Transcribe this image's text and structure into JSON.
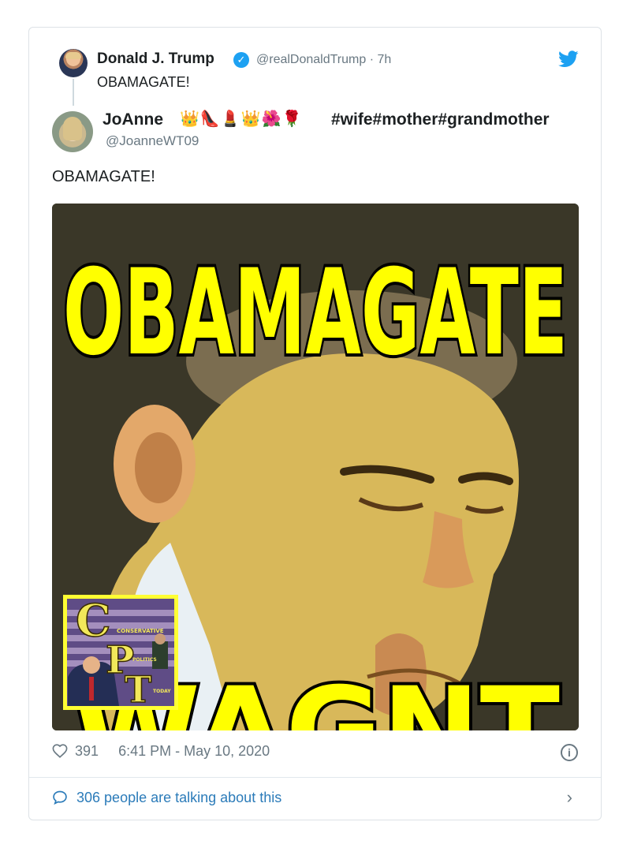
{
  "outer_tweet": {
    "author_name": "Donald J. Trump",
    "verified_glyph": "✓",
    "handle": "@realDonaldTrump",
    "time_sep": "·",
    "time": "7h",
    "text": "OBAMAGATE!"
  },
  "quoted_tweet": {
    "author_name": "JoAnne",
    "emojis": "👑👠💄👑🌺🌹",
    "hashtags": "#wife#mother#grandmother",
    "handle": "@JoanneWT09",
    "text": "OBAMAGATE!"
  },
  "media": {
    "headline": "OBAMAGATE",
    "bottom_partial": "WAGNT",
    "logo": {
      "c": "C",
      "p": "P",
      "t": "T",
      "word1": "CONSERVATIVE",
      "word2": "POLITICS",
      "word3": "TODAY"
    }
  },
  "footer": {
    "likes": "391",
    "timestamp": "6:41 PM - May 10, 2020",
    "info_glyph": "i",
    "talking": "306 people are talking about this",
    "chevron": "›"
  },
  "colors": {
    "twitter_blue": "#1da1f2",
    "link_blue": "#2b7bb9",
    "muted_gray": "#697882",
    "headline_yellow": "#ffff00"
  },
  "icons": [
    "verified-badge-icon",
    "twitter-bird-icon",
    "heart-icon",
    "info-icon",
    "comment-bubble-icon",
    "chevron-right-icon"
  ]
}
